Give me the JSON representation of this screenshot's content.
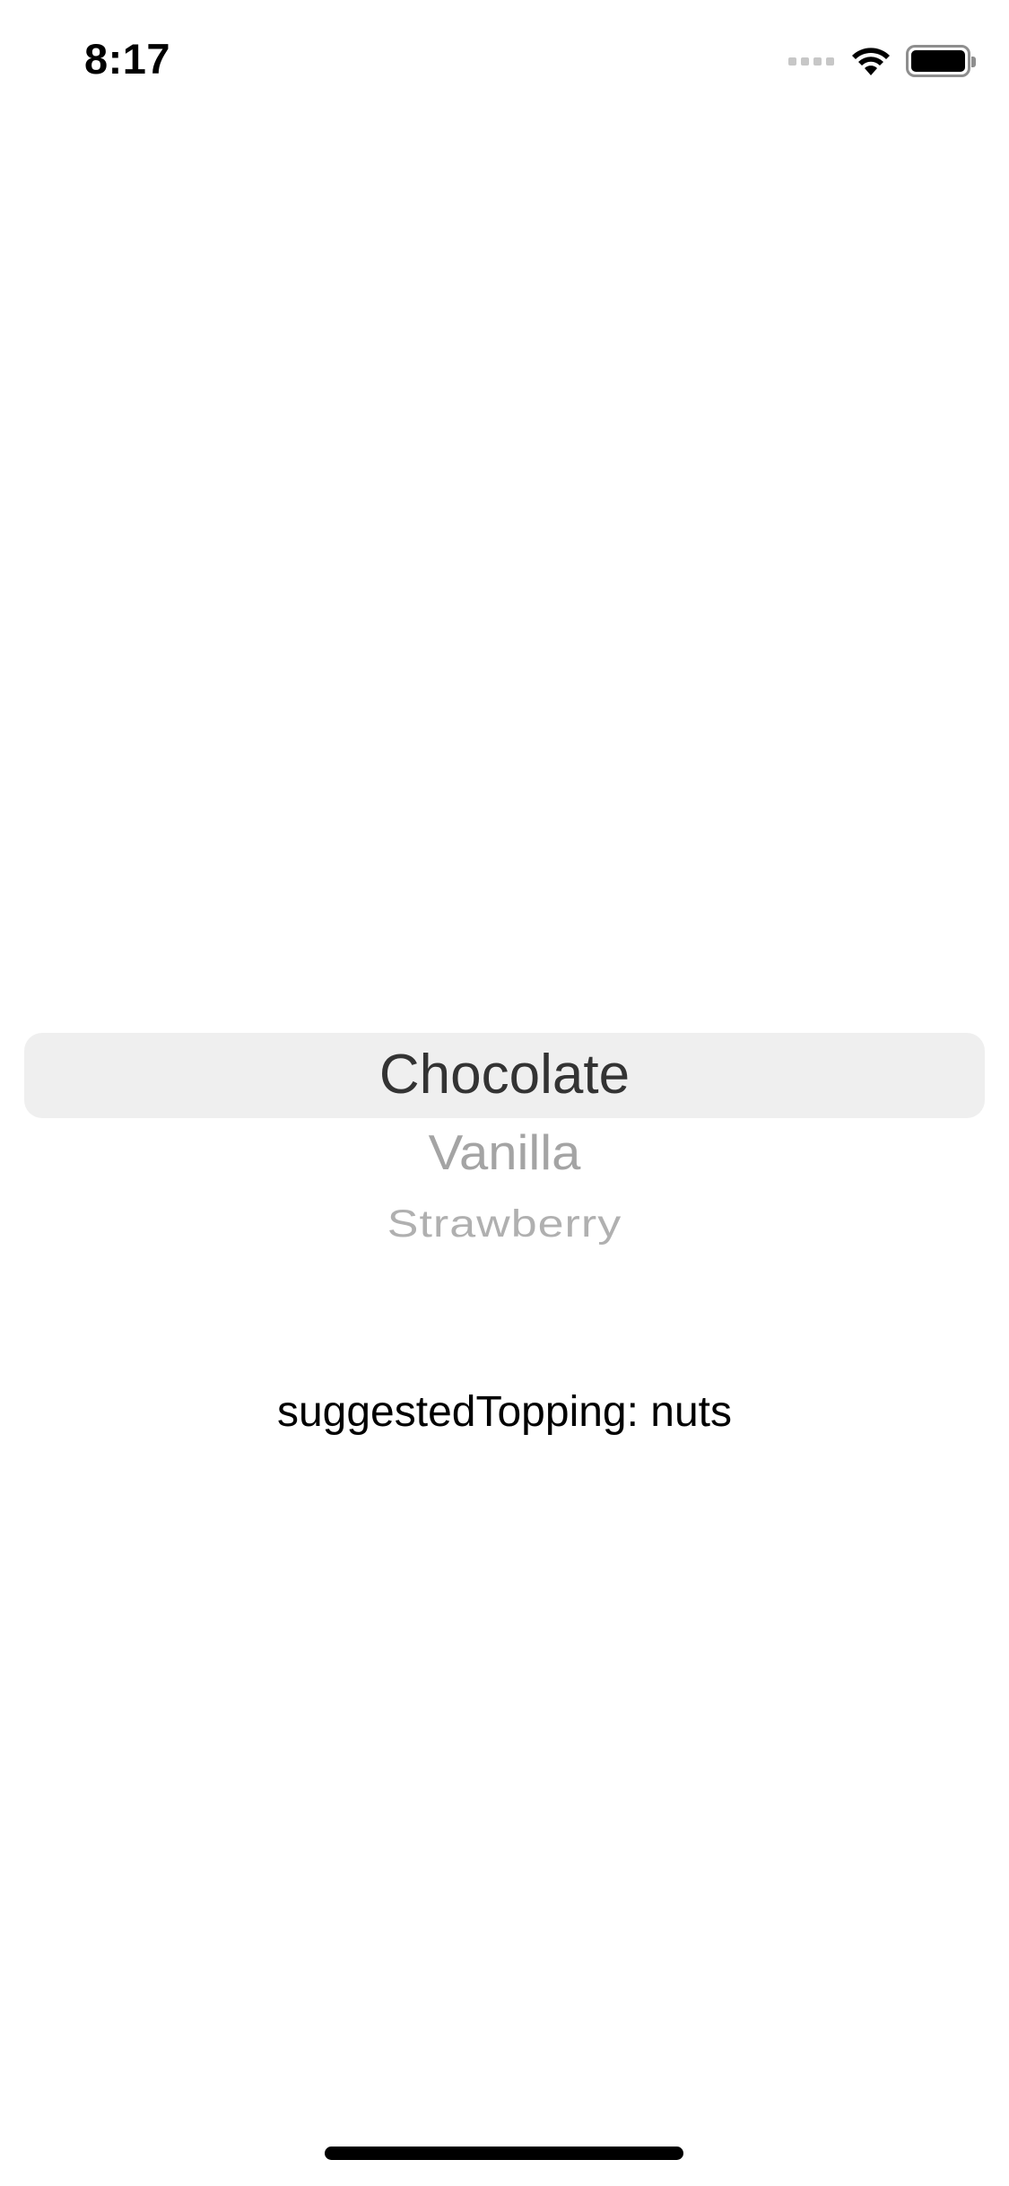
{
  "status_bar": {
    "time": "8:17",
    "signal_icon": "cellular-signal-icon",
    "wifi_icon": "wifi-icon",
    "battery_icon": "battery-icon"
  },
  "picker": {
    "options": [
      "Chocolate",
      "Vanilla",
      "Strawberry"
    ],
    "selected": "Chocolate",
    "highlight_color": "#efefef"
  },
  "suggested_topping": {
    "text": "suggestedTopping: nuts"
  }
}
